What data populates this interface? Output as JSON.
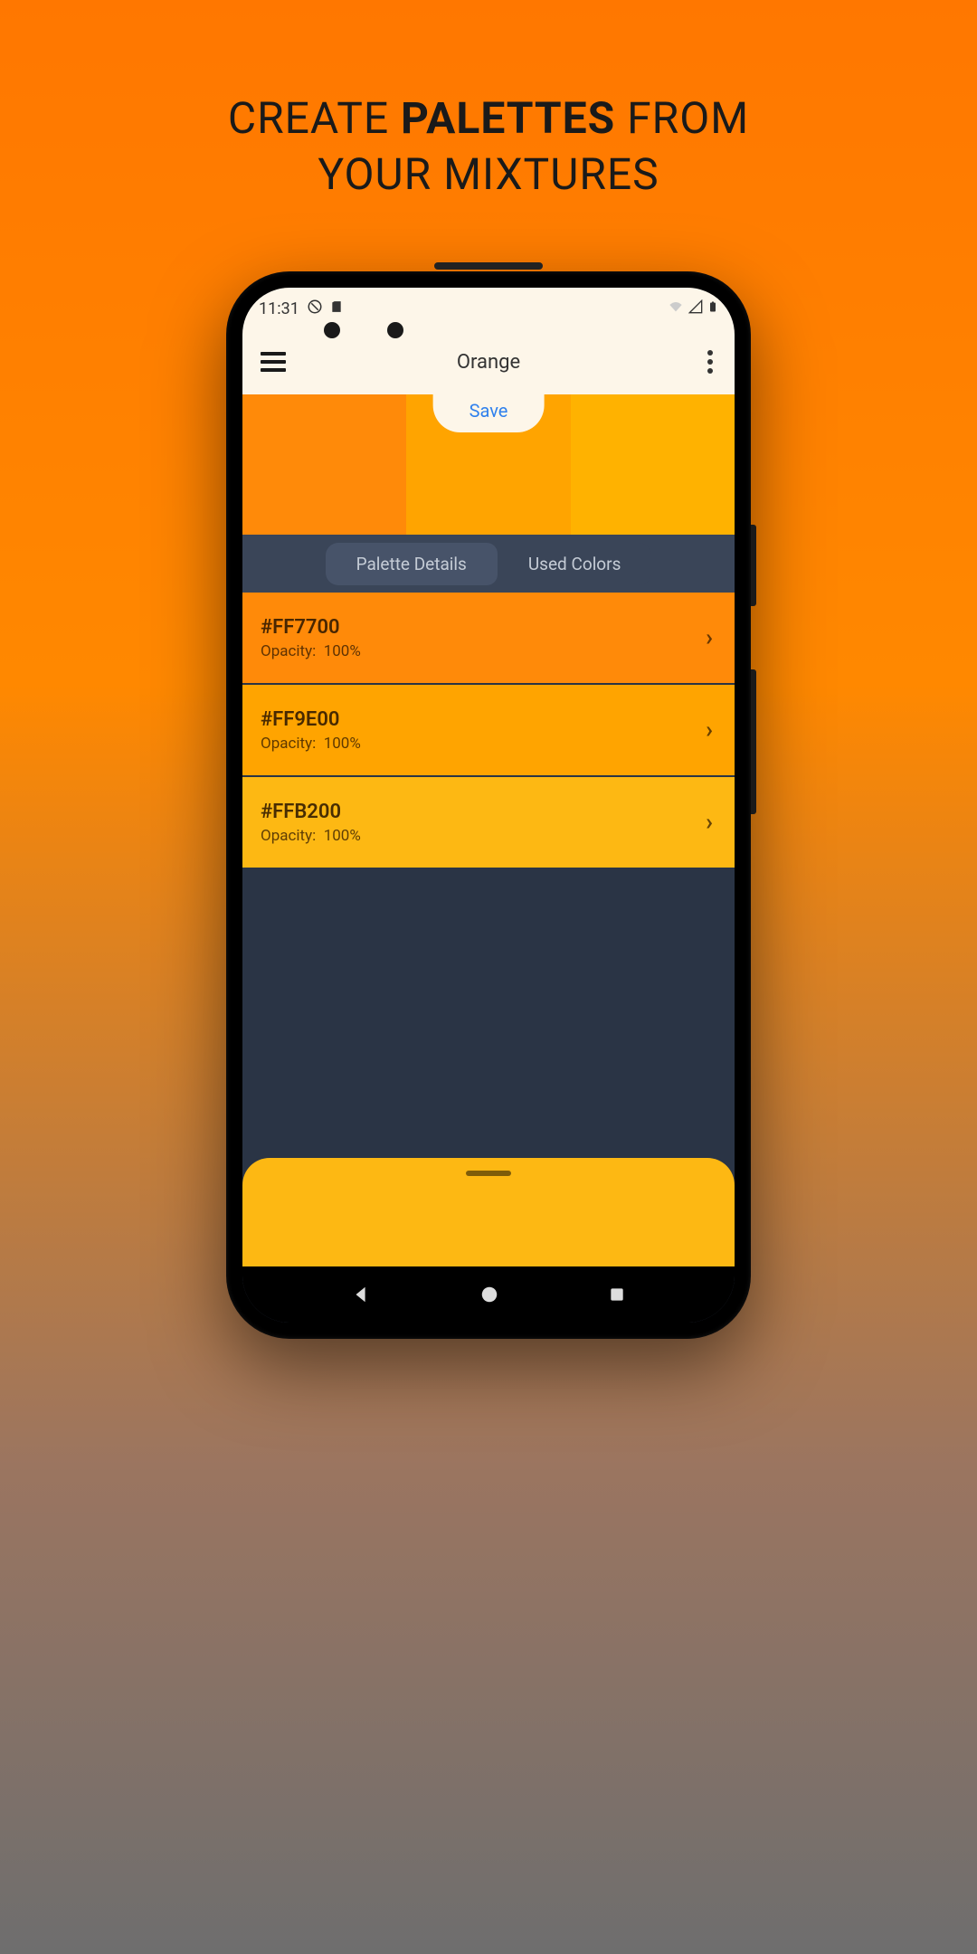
{
  "promo": {
    "line1_pre": "CREATE ",
    "line1_bold": "PALETTES",
    "line1_post": " FROM",
    "line2": "YOUR MIXTURES"
  },
  "status": {
    "time": "11:31"
  },
  "header": {
    "title": "Orange",
    "save_label": "Save"
  },
  "swatches": [
    {
      "color": "#FF8A09"
    },
    {
      "color": "#FFA400"
    },
    {
      "color": "#FFB200"
    }
  ],
  "tabs": {
    "details": "Palette Details",
    "used": "Used Colors"
  },
  "colors": [
    {
      "hex": "#FF7700",
      "opacity_label": "Opacity:",
      "opacity_value": "100%",
      "bg": "#FF8A09"
    },
    {
      "hex": "#FF9E00",
      "opacity_label": "Opacity:",
      "opacity_value": "100%",
      "bg": "#FFA400"
    },
    {
      "hex": "#FFB200",
      "opacity_label": "Opacity:",
      "opacity_value": "100%",
      "bg": "#FDB813"
    }
  ]
}
